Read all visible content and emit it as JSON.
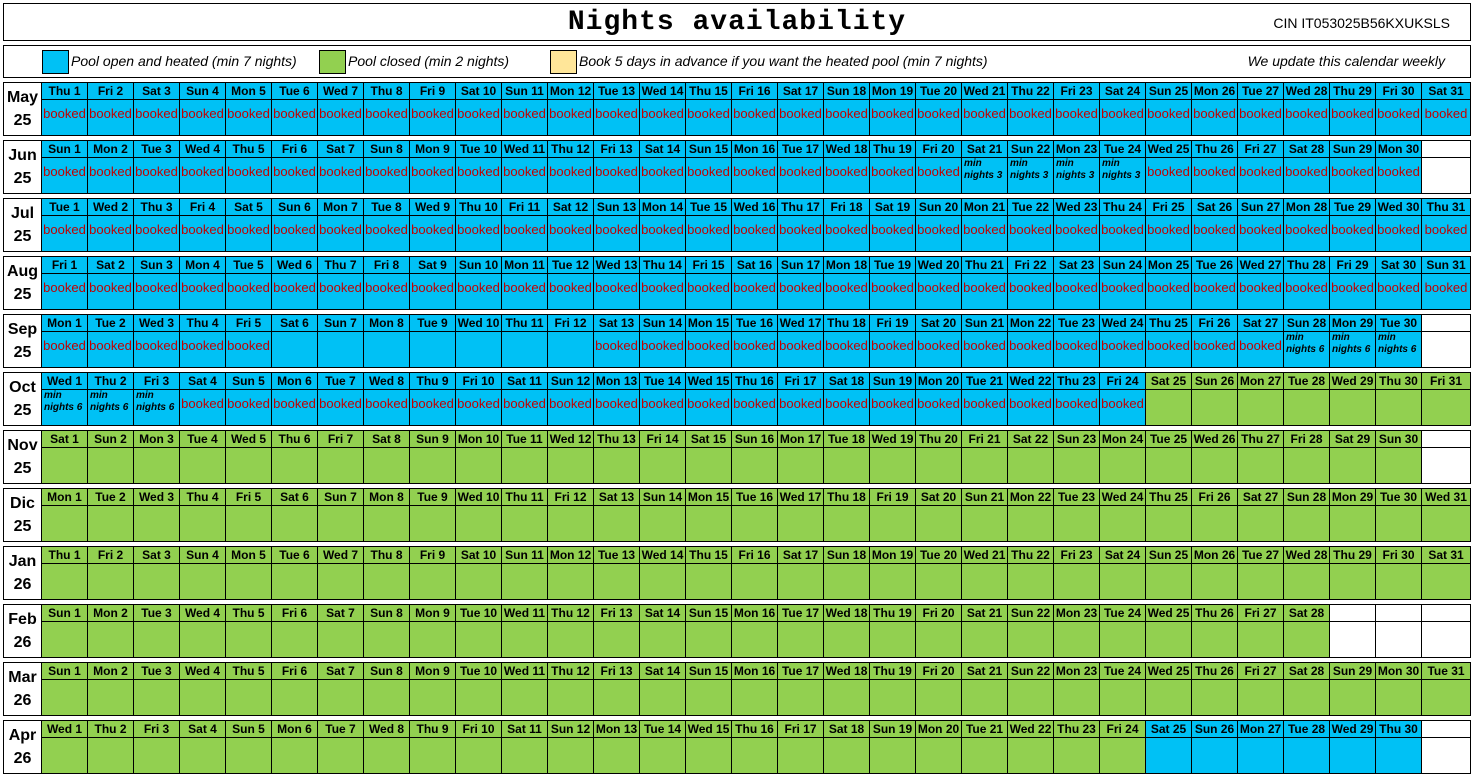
{
  "title": "Nights availability",
  "cin": "CIN IT053025B56KXUKSLS",
  "legend": {
    "items": [
      {
        "color": "#00c1f5",
        "label": "Pool open and heated (min 7 nights)"
      },
      {
        "color": "#92d050",
        "label": "Pool closed (min 2 nights)"
      },
      {
        "color": "#ffe699",
        "label": "Book 5 days in advance if you want the heated pool (min 7 nights)"
      }
    ],
    "update_note": "We update this calendar weekly"
  },
  "colors": {
    "blue": "#00c1f5",
    "green": "#92d050",
    "yellow": "#ffe699",
    "booked_text": "#c00000"
  },
  "booked_label": "booked",
  "months": [
    {
      "name": "May",
      "year": "25",
      "days": [
        "Thu 1",
        "Fri 2",
        "Sat 3",
        "Sun 4",
        "Mon 5",
        "Tue 6",
        "Wed 7",
        "Thu 8",
        "Fri 9",
        "Sat 10",
        "Sun 11",
        "Mon 12",
        "Tue 13",
        "Wed 14",
        "Thu 15",
        "Fri 16",
        "Sat 17",
        "Sun 18",
        "Mon 19",
        "Tue 20",
        "Wed 21",
        "Thu 22",
        "Fri 23",
        "Sat 24",
        "Sun 25",
        "Mon 26",
        "Tue 27",
        "Wed 28",
        "Thu 29",
        "Fri 30",
        "Sat 31"
      ],
      "color": "BBBBBBBBBBBBBBBBBBBBBBBBBBBBBBB",
      "status": "bbbbbbbbbbbbbbbbbbbbbbbbbbbbbbb",
      "notes": {}
    },
    {
      "name": "Jun",
      "year": "25",
      "days": [
        "Sun 1",
        "Mon 2",
        "Tue 3",
        "Wed 4",
        "Thu 5",
        "Fri 6",
        "Sat 7",
        "Sun 8",
        "Mon 9",
        "Tue 10",
        "Wed 11",
        "Thu 12",
        "Fri 13",
        "Sat 14",
        "Sun 15",
        "Mon 16",
        "Tue 17",
        "Wed 18",
        "Thu 19",
        "Fri 20",
        "Sat 21",
        "Sun 22",
        "Mon 23",
        "Tue 24",
        "Wed 25",
        "Thu 26",
        "Fri 27",
        "Sat 28",
        "Sun 29",
        "Mon 30"
      ],
      "color": "BBBBBBBBBBBBBBBBBBBBBBBBBBBBBB",
      "status": "bbbbbbbbbbbbbbbbbbbb....bbbbbb",
      "notes": {
        "20": "min nights 3",
        "21": "min nights 3",
        "22": "min nights 3",
        "23": "min nights 3"
      }
    },
    {
      "name": "Jul",
      "year": "25",
      "days": [
        "Tue 1",
        "Wed 2",
        "Thu 3",
        "Fri 4",
        "Sat 5",
        "Sun 6",
        "Mon 7",
        "Tue 8",
        "Wed 9",
        "Thu 10",
        "Fri 11",
        "Sat 12",
        "Sun 13",
        "Mon 14",
        "Tue 15",
        "Wed 16",
        "Thu 17",
        "Fri 18",
        "Sat 19",
        "Sun 20",
        "Mon 21",
        "Tue 22",
        "Wed 23",
        "Thu 24",
        "Fri 25",
        "Sat 26",
        "Sun 27",
        "Mon 28",
        "Tue 29",
        "Wed 30",
        "Thu 31"
      ],
      "color": "BBBBBBBBBBBBBBBBBBBBBBBBBBBBBBB",
      "status": "bbbbbbbbbbbbbbbbbbbbbbbbbbbbbbb",
      "notes": {}
    },
    {
      "name": "Aug",
      "year": "25",
      "days": [
        "Fri 1",
        "Sat 2",
        "Sun 3",
        "Mon 4",
        "Tue 5",
        "Wed 6",
        "Thu 7",
        "Fri 8",
        "Sat 9",
        "Sun 10",
        "Mon 11",
        "Tue 12",
        "Wed 13",
        "Thu 14",
        "Fri 15",
        "Sat 16",
        "Sun 17",
        "Mon 18",
        "Tue 19",
        "Wed 20",
        "Thu 21",
        "Fri 22",
        "Sat 23",
        "Sun 24",
        "Mon 25",
        "Tue 26",
        "Wed 27",
        "Thu 28",
        "Fri 29",
        "Sat 30",
        "Sun 31"
      ],
      "color": "BBBBBBBBBBBBBBBBBBBBBBBBBBBBBBB",
      "status": "bbbbbbbbbbbbbbbbbbbbbbbbbbbbbbb",
      "notes": {}
    },
    {
      "name": "Sep",
      "year": "25",
      "days": [
        "Mon 1",
        "Tue 2",
        "Wed 3",
        "Thu 4",
        "Fri 5",
        "Sat 6",
        "Sun 7",
        "Mon 8",
        "Tue 9",
        "Wed 10",
        "Thu 11",
        "Fri 12",
        "Sat 13",
        "Sun 14",
        "Mon 15",
        "Tue 16",
        "Wed 17",
        "Thu 18",
        "Fri 19",
        "Sat 20",
        "Sun 21",
        "Mon 22",
        "Tue 23",
        "Wed 24",
        "Thu 25",
        "Fri 26",
        "Sat 27",
        "Sun 28",
        "Mon 29",
        "Tue 30"
      ],
      "color": "BBBBBBBBBBBBBBBBBBBBBBBBBBBBBB",
      "status": "bbbbb.......bbbbbbbbbbbbbbb...",
      "notes": {
        "27": "min nights 6",
        "28": "min nights 6",
        "29": "min nights 6"
      }
    },
    {
      "name": "Oct",
      "year": "25",
      "days": [
        "Wed 1",
        "Thu 2",
        "Fri 3",
        "Sat 4",
        "Sun 5",
        "Mon 6",
        "Tue 7",
        "Wed 8",
        "Thu 9",
        "Fri 10",
        "Sat 11",
        "Sun 12",
        "Mon 13",
        "Tue 14",
        "Wed 15",
        "Thu 16",
        "Fri 17",
        "Sat 18",
        "Sun 19",
        "Mon 20",
        "Tue 21",
        "Wed 22",
        "Thu 23",
        "Fri 24",
        "Sat 25",
        "Sun 26",
        "Mon 27",
        "Tue 28",
        "Wed 29",
        "Thu 30",
        "Fri 31"
      ],
      "color": "BBBBBBBBBBBBBBBBBBBBBBBBGGGGGGG",
      "status": "...bbbbbbbbbbbbbbbbbbbbb.......",
      "notes": {
        "0": "min nights 6",
        "1": "min nights 6",
        "2": "min nights 6"
      }
    },
    {
      "name": "Nov",
      "year": "25",
      "days": [
        "Sat 1",
        "Sun 2",
        "Mon 3",
        "Tue 4",
        "Wed 5",
        "Thu 6",
        "Fri 7",
        "Sat 8",
        "Sun 9",
        "Mon 10",
        "Tue 11",
        "Wed 12",
        "Thu 13",
        "Fri 14",
        "Sat 15",
        "Sun 16",
        "Mon 17",
        "Tue 18",
        "Wed 19",
        "Thu 20",
        "Fri 21",
        "Sat 22",
        "Sun 23",
        "Mon 24",
        "Tue 25",
        "Wed 26",
        "Thu 27",
        "Fri 28",
        "Sat 29",
        "Sun 30"
      ],
      "color": "GGGGGGGGGGGGGGGGGGGGGGGGGGGGGG",
      "status": "..............................",
      "notes": {}
    },
    {
      "name": "Dic",
      "year": "25",
      "days": [
        "Mon 1",
        "Tue 2",
        "Wed 3",
        "Thu 4",
        "Fri 5",
        "Sat 6",
        "Sun 7",
        "Mon 8",
        "Tue 9",
        "Wed 10",
        "Thu 11",
        "Fri 12",
        "Sat 13",
        "Sun 14",
        "Mon 15",
        "Tue 16",
        "Wed 17",
        "Thu 18",
        "Fri 19",
        "Sat 20",
        "Sun 21",
        "Mon 22",
        "Tue 23",
        "Wed 24",
        "Thu 25",
        "Fri 26",
        "Sat 27",
        "Sun 28",
        "Mon 29",
        "Tue 30",
        "Wed 31"
      ],
      "color": "GGGGGGGGGGGGGGGGGGGGGGGGGGGGGGG",
      "status": "...............................",
      "notes": {}
    },
    {
      "name": "Jan",
      "year": "26",
      "days": [
        "Thu 1",
        "Fri 2",
        "Sat 3",
        "Sun 4",
        "Mon 5",
        "Tue 6",
        "Wed 7",
        "Thu 8",
        "Fri 9",
        "Sat 10",
        "Sun 11",
        "Mon 12",
        "Tue 13",
        "Wed 14",
        "Thu 15",
        "Fri 16",
        "Sat 17",
        "Sun 18",
        "Mon 19",
        "Tue 20",
        "Wed 21",
        "Thu 22",
        "Fri 23",
        "Sat 24",
        "Sun 25",
        "Mon 26",
        "Tue 27",
        "Wed 28",
        "Thu 29",
        "Fri 30",
        "Sat 31"
      ],
      "color": "GGGGGGGGGGGGGGGGGGGGGGGGGGGGGGG",
      "status": "...............................",
      "notes": {}
    },
    {
      "name": "Feb",
      "year": "26",
      "days": [
        "Sun 1",
        "Mon 2",
        "Tue 3",
        "Wed 4",
        "Thu 5",
        "Fri 6",
        "Sat 7",
        "Sun 8",
        "Mon 9",
        "Tue 10",
        "Wed 11",
        "Thu 12",
        "Fri 13",
        "Sat 14",
        "Sun 15",
        "Mon 16",
        "Tue 17",
        "Wed 18",
        "Thu 19",
        "Fri 20",
        "Sat 21",
        "Sun 22",
        "Mon 23",
        "Tue 24",
        "Wed 25",
        "Thu 26",
        "Fri 27",
        "Sat 28"
      ],
      "color": "GGGGGGGGGGGGGGGGGGGGGGGGGGGG",
      "status": "............................",
      "notes": {}
    },
    {
      "name": "Mar",
      "year": "26",
      "days": [
        "Sun 1",
        "Mon 2",
        "Tue 3",
        "Wed 4",
        "Thu 5",
        "Fri 6",
        "Sat 7",
        "Sun 8",
        "Mon 9",
        "Tue 10",
        "Wed 11",
        "Thu 12",
        "Fri 13",
        "Sat 14",
        "Sun 15",
        "Mon 16",
        "Tue 17",
        "Wed 18",
        "Thu 19",
        "Fri 20",
        "Sat 21",
        "Sun 22",
        "Mon 23",
        "Tue 24",
        "Wed 25",
        "Thu 26",
        "Fri 27",
        "Sat 28",
        "Sun 29",
        "Mon 30",
        "Tue 31"
      ],
      "color": "GGGGGGGGGGGGGGGGGGGGGGGGGGGGGGG",
      "status": "...............................",
      "notes": {}
    },
    {
      "name": "Apr",
      "year": "26",
      "days": [
        "Wed 1",
        "Thu 2",
        "Fri 3",
        "Sat 4",
        "Sun 5",
        "Mon 6",
        "Tue 7",
        "Wed 8",
        "Thu 9",
        "Fri 10",
        "Sat 11",
        "Sun 12",
        "Mon 13",
        "Tue 14",
        "Wed 15",
        "Thu 16",
        "Fri 17",
        "Sat 18",
        "Sun 19",
        "Mon 20",
        "Tue 21",
        "Wed 22",
        "Thu 23",
        "Fri 24",
        "Sat 25",
        "Sun 26",
        "Mon 27",
        "Tue 28",
        "Wed 29",
        "Thu 30"
      ],
      "color": "GGGGGGGGGGGGGGGGGGGGGGGGBBBBBB",
      "status": "..............................",
      "notes": {}
    }
  ]
}
